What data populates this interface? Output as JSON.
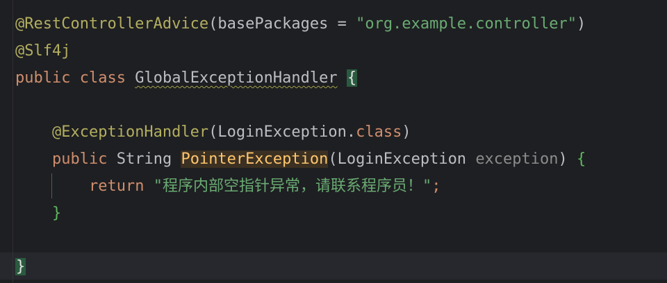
{
  "code": {
    "line1": {
      "annotation": "@RestControllerAdvice",
      "open_paren": "(",
      "attr": "basePackages",
      "eq": " = ",
      "value": "\"org.example.controller\"",
      "close_paren": ")"
    },
    "line2": {
      "annotation": "@Slf4j"
    },
    "line3": {
      "kw_public": "public",
      "kw_class": "class",
      "class_name": "GlobalExceptionHandler",
      "open_brace": "{"
    },
    "line5": {
      "annotation": "@ExceptionHandler",
      "open_paren": "(",
      "type": "LoginException",
      "dot": ".",
      "kw_class": "class",
      "close_paren": ")"
    },
    "line6": {
      "kw_public": "public",
      "return_type": "String",
      "method_name": "PointerException",
      "open_paren": "(",
      "param_type": "LoginException",
      "param_name": "exception",
      "close_paren": ")",
      "open_brace": "{"
    },
    "line7": {
      "kw_return": "return",
      "string": "\"程序内部空指针异常，请联系程序员！\"",
      "semicolon": ";"
    },
    "line8": {
      "close_brace": "}"
    },
    "line10": {
      "close_brace": "}"
    }
  }
}
